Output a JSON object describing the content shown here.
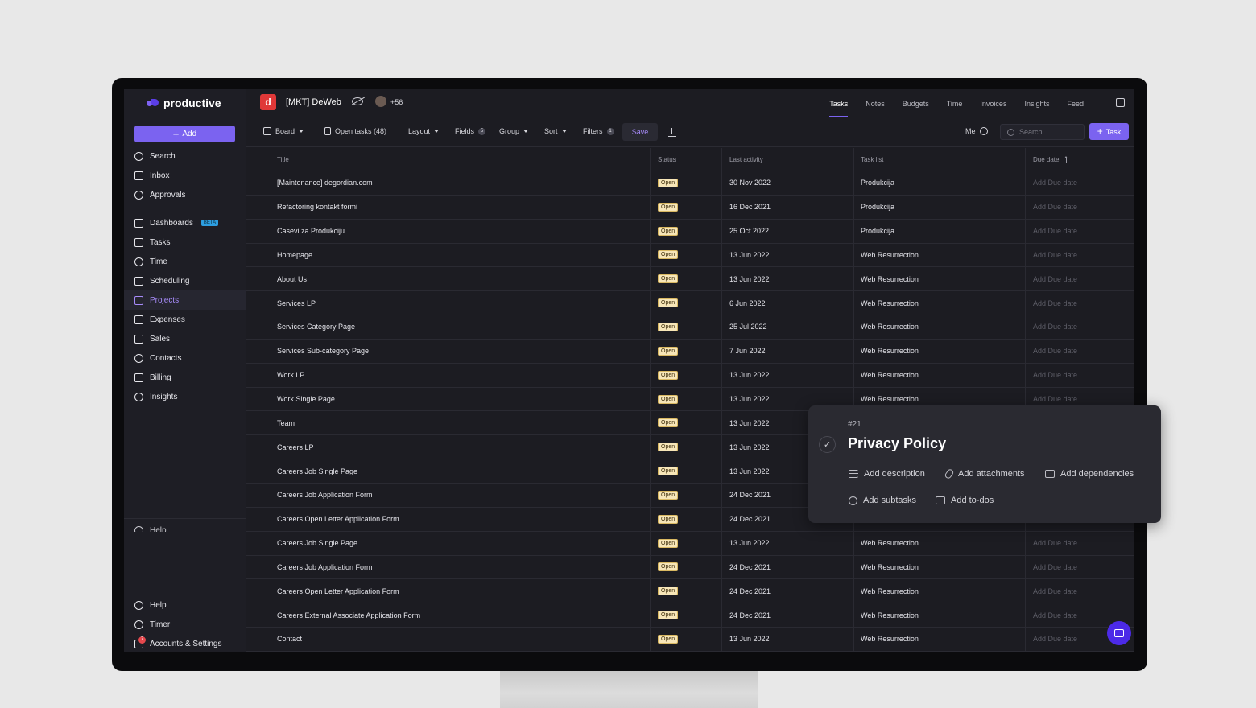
{
  "app": {
    "logo": "productive"
  },
  "sidebar": {
    "add_label": "Add",
    "top_items": [
      {
        "label": "Search",
        "icon": "search-icon"
      },
      {
        "label": "Inbox",
        "icon": "inbox-icon"
      },
      {
        "label": "Approvals",
        "icon": "check-circle-icon"
      }
    ],
    "main_items": [
      {
        "label": "Dashboards",
        "icon": "dashboard-icon",
        "badge": "BETA"
      },
      {
        "label": "Tasks",
        "icon": "clipboard-icon"
      },
      {
        "label": "Time",
        "icon": "clock-icon"
      },
      {
        "label": "Scheduling",
        "icon": "calendar-icon"
      },
      {
        "label": "Projects",
        "icon": "folder-icon",
        "active": true
      },
      {
        "label": "Expenses",
        "icon": "cart-icon"
      },
      {
        "label": "Sales",
        "icon": "funnel-icon"
      },
      {
        "label": "Contacts",
        "icon": "people-icon"
      },
      {
        "label": "Billing",
        "icon": "banknote-icon"
      },
      {
        "label": "Insights",
        "icon": "pie-icon"
      }
    ],
    "help_cut": "Help",
    "bottom_items": [
      {
        "label": "Help",
        "icon": "help-icon"
      },
      {
        "label": "Timer",
        "icon": "stopwatch-icon"
      },
      {
        "label": "Accounts & Settings",
        "icon": "settings-icon"
      }
    ],
    "account_badge": "7"
  },
  "header": {
    "project_title": "[MKT] DeWeb",
    "members_more": "+56",
    "tabs": [
      "Tasks",
      "Notes",
      "Budgets",
      "Time",
      "Invoices",
      "Insights",
      "Feed"
    ],
    "active_tab": "Tasks"
  },
  "toolbar": {
    "board": "Board",
    "open_tasks": "Open tasks (48)",
    "layout": "Layout",
    "fields": "Fields",
    "fields_count": "5",
    "group": "Group",
    "sort": "Sort",
    "filters": "Filters",
    "filters_count": "1",
    "save": "Save",
    "me": "Me",
    "search_placeholder": "Search",
    "task_button": "Task"
  },
  "table": {
    "columns": [
      "Title",
      "Status",
      "Last activity",
      "Task list",
      "Due date"
    ],
    "due_placeholder": "Add Due date",
    "rows": [
      {
        "title": "[Maintenance] degordian.com",
        "status": "Open",
        "activity": "30 Nov 2022",
        "list": "Produkcija"
      },
      {
        "title": "Refactoring kontakt formi",
        "status": "Open",
        "activity": "16 Dec 2021",
        "list": "Produkcija"
      },
      {
        "title": "Casevi za Produkciju",
        "status": "Open",
        "activity": "25 Oct 2022",
        "list": "Produkcija"
      },
      {
        "title": "Homepage",
        "status": "Open",
        "activity": "13 Jun 2022",
        "list": "Web Resurrection"
      },
      {
        "title": "About Us",
        "status": "Open",
        "activity": "13 Jun 2022",
        "list": "Web Resurrection"
      },
      {
        "title": "Services LP",
        "status": "Open",
        "activity": "6 Jun 2022",
        "list": "Web Resurrection"
      },
      {
        "title": "Services Category Page",
        "status": "Open",
        "activity": "25 Jul 2022",
        "list": "Web Resurrection"
      },
      {
        "title": "Services Sub-category Page",
        "status": "Open",
        "activity": "7 Jun 2022",
        "list": "Web Resurrection"
      },
      {
        "title": "Work LP",
        "status": "Open",
        "activity": "13 Jun 2022",
        "list": "Web Resurrection"
      },
      {
        "title": "Work Single Page",
        "status": "Open",
        "activity": "13 Jun 2022",
        "list": "Web Resurrection"
      },
      {
        "title": "Team",
        "status": "Open",
        "activity": "13 Jun 2022",
        "list": "",
        "due": ""
      },
      {
        "title": "Careers LP",
        "status": "Open",
        "activity": "13 Jun 2022",
        "list": "",
        "due": ""
      },
      {
        "title": "Careers Job Single Page",
        "status": "Open",
        "activity": "13 Jun 2022",
        "list": "",
        "due": ""
      },
      {
        "title": "Careers Job Application Form",
        "status": "Open",
        "activity": "24 Dec 2021",
        "list": "",
        "due": ""
      },
      {
        "title": "Careers Open Letter Application Form",
        "status": "Open",
        "activity": "24 Dec 2021",
        "list": "",
        "due": ""
      },
      {
        "title": "Careers Job Single Page",
        "status": "Open",
        "activity": "13 Jun 2022",
        "list": "Web Resurrection"
      },
      {
        "title": "Careers Job Application Form",
        "status": "Open",
        "activity": "24 Dec 2021",
        "list": "Web Resurrection"
      },
      {
        "title": "Careers Open Letter Application Form",
        "status": "Open",
        "activity": "24 Dec 2021",
        "list": "Web Resurrection"
      },
      {
        "title": "Careers External Associate Application Form",
        "status": "Open",
        "activity": "24 Dec 2021",
        "list": "Web Resurrection"
      },
      {
        "title": "Contact",
        "status": "Open",
        "activity": "13 Jun 2022",
        "list": "Web Resurrection"
      }
    ]
  },
  "popup": {
    "id": "#21",
    "title": "Privacy Policy",
    "actions": [
      {
        "label": "Add description",
        "icon": "description-icon"
      },
      {
        "label": "Add attachments",
        "icon": "paperclip-icon"
      },
      {
        "label": "Add dependencies",
        "icon": "dependencies-icon"
      },
      {
        "label": "Add subtasks",
        "icon": "subtasks-icon"
      },
      {
        "label": "Add to-dos",
        "icon": "todo-icon"
      }
    ]
  }
}
